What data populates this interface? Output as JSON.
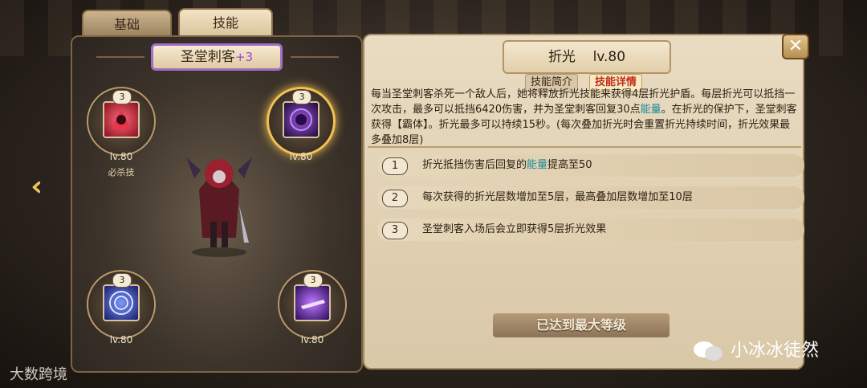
{
  "tabs": {
    "basic": "基础",
    "skill": "技能"
  },
  "hero": {
    "name": "圣堂刺客",
    "plus": "+3"
  },
  "skills": [
    {
      "id": "s1",
      "badge": "3",
      "level": "lv.80",
      "tag": "必杀技",
      "icon": "red-hooded-assassin-icon",
      "color": "#c8283c"
    },
    {
      "id": "s2",
      "badge": "3",
      "level": "lv.80",
      "tag": "",
      "icon": "purple-dark-orb-icon",
      "color": "#5a2a9a",
      "active": true
    },
    {
      "id": "s3",
      "badge": "3",
      "level": "lv.80",
      "tag": "",
      "icon": "blue-rune-circle-icon",
      "color": "#2a3a9a"
    },
    {
      "id": "s4",
      "badge": "3",
      "level": "lv.80",
      "tag": "",
      "icon": "purple-blade-strike-icon",
      "color": "#6a2aa8"
    }
  ],
  "detail": {
    "title": "折光",
    "level": "lv.80",
    "subtab_intro": "技能简介",
    "subtab_detail": "技能详情",
    "desc_part1": "每当圣堂刺客杀死一个敌人后，她将释放折光技能来获得4层折光护盾。每层折光可以抵挡一次攻击，最多可以抵挡6420伤害，并为圣堂刺客回复30点",
    "desc_hl": "能量",
    "desc_part2": "。在折光的保护下，圣堂刺客获得【霸体】。折光最多可以持续15秒。(每次叠加折光时会重置折光持续时间，折光效果最多叠加8层)",
    "upgrades": [
      {
        "num": "1",
        "text_a": "折光抵挡伤害后回复的",
        "hl": "能量",
        "text_b": "提高至50"
      },
      {
        "num": "2",
        "text_a": "每次获得的折光层数增加至5层，最高叠加层数增加至10层",
        "hl": "",
        "text_b": ""
      },
      {
        "num": "3",
        "text_a": "圣堂刺客入场后会立即获得5层折光效果",
        "hl": "",
        "text_b": ""
      }
    ],
    "max_level": "已达到最大等级"
  },
  "close_label": "✕",
  "watermark_left": "大数跨境",
  "watermark_right": "小冰冰徒然"
}
